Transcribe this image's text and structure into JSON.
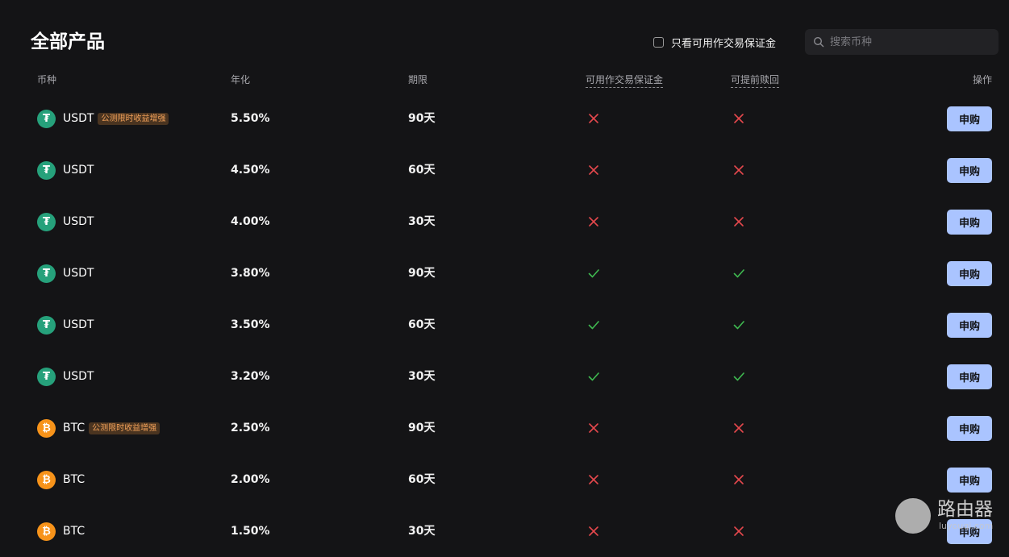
{
  "title": "全部产品",
  "filter": {
    "label": "只看可用作交易保证金",
    "checked": false
  },
  "search": {
    "placeholder": "搜索币种",
    "value": ""
  },
  "columns": {
    "coin": "币种",
    "rate": "年化",
    "term": "期限",
    "margin": "可用作交易保证金",
    "early": "可提前赎回",
    "action": "操作"
  },
  "colors": {
    "cross": "#e5484d",
    "check": "#3fb950",
    "usdt": "#26a17b",
    "btc": "#f7931a",
    "button": "#aac4ff"
  },
  "rows": [
    {
      "coin": "USDT",
      "icon": "usdt-icon",
      "badge": "公测限时收益增强",
      "rate": "5.50%",
      "term": "90天",
      "margin": false,
      "early": false,
      "action": "申购"
    },
    {
      "coin": "USDT",
      "icon": "usdt-icon",
      "badge": "",
      "rate": "4.50%",
      "term": "60天",
      "margin": false,
      "early": false,
      "action": "申购"
    },
    {
      "coin": "USDT",
      "icon": "usdt-icon",
      "badge": "",
      "rate": "4.00%",
      "term": "30天",
      "margin": false,
      "early": false,
      "action": "申购"
    },
    {
      "coin": "USDT",
      "icon": "usdt-icon",
      "badge": "",
      "rate": "3.80%",
      "term": "90天",
      "margin": true,
      "early": true,
      "action": "申购"
    },
    {
      "coin": "USDT",
      "icon": "usdt-icon",
      "badge": "",
      "rate": "3.50%",
      "term": "60天",
      "margin": true,
      "early": true,
      "action": "申购"
    },
    {
      "coin": "USDT",
      "icon": "usdt-icon",
      "badge": "",
      "rate": "3.20%",
      "term": "30天",
      "margin": true,
      "early": true,
      "action": "申购"
    },
    {
      "coin": "BTC",
      "icon": "btc-icon",
      "badge": "公测限时收益增强",
      "rate": "2.50%",
      "term": "90天",
      "margin": false,
      "early": false,
      "action": "申购"
    },
    {
      "coin": "BTC",
      "icon": "btc-icon",
      "badge": "",
      "rate": "2.00%",
      "term": "60天",
      "margin": false,
      "early": false,
      "action": "申购"
    },
    {
      "coin": "BTC",
      "icon": "btc-icon",
      "badge": "",
      "rate": "1.50%",
      "term": "30天",
      "margin": false,
      "early": false,
      "action": "申购"
    }
  ],
  "watermark": {
    "text": "路由器",
    "sub": "luyouqi.com"
  }
}
